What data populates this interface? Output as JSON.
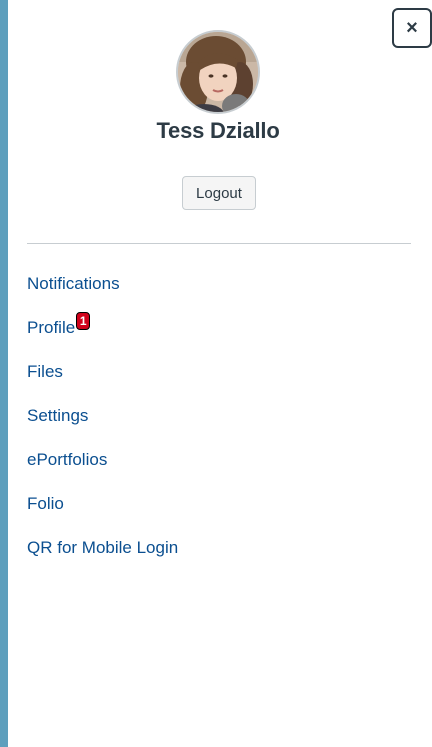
{
  "user": {
    "name": "Tess Dziallo"
  },
  "actions": {
    "logout_label": "Logout",
    "close_symbol": "×"
  },
  "menu": {
    "items": [
      {
        "label": "Notifications"
      },
      {
        "label": "Profile",
        "badge": "1"
      },
      {
        "label": "Files"
      },
      {
        "label": "Settings"
      },
      {
        "label": "ePortfolios"
      },
      {
        "label": "Folio"
      },
      {
        "label": "QR for Mobile Login"
      }
    ]
  },
  "colors": {
    "link": "#0b4f90",
    "text": "#2d3b45",
    "badge": "#d0021b",
    "background_edge": "#5e9fbd"
  }
}
